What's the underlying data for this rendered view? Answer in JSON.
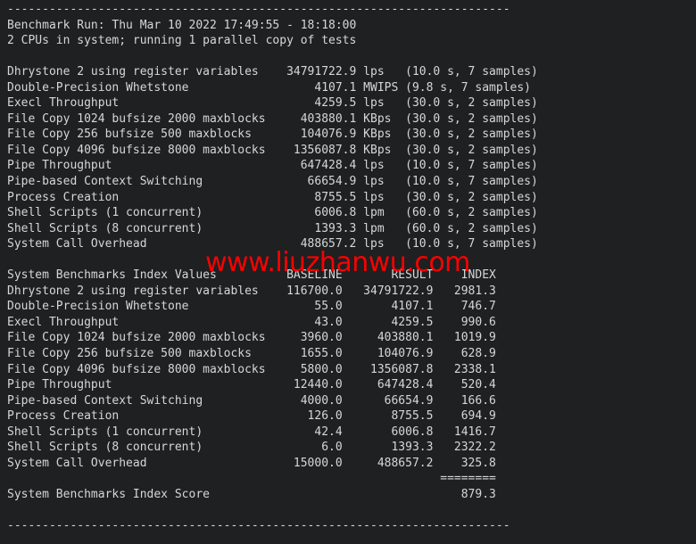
{
  "terminal": {
    "background_color": "#1e2022",
    "text_color": "#d6d8d6",
    "rule_top": "------------------------------------------------------------------------",
    "rule_bottom": "------------------------------------------------------------------------",
    "header": {
      "benchmark_run_label": "Benchmark Run:",
      "benchmark_run_value": "Thu Mar 10 2022 17:49:55 - 18:18:00",
      "cpu_line": "2 CPUs in system; running 1 parallel copy of tests"
    },
    "results_header": {
      "name": "",
      "value": "",
      "unit": "",
      "timing": ""
    },
    "results": [
      {
        "name": "Dhrystone 2 using register variables",
        "value": "34791722.9",
        "unit": "lps",
        "timing": "(10.0 s, 7 samples)"
      },
      {
        "name": "Double-Precision Whetstone",
        "value": "4107.1",
        "unit": "MWIPS",
        "timing": "(9.8 s, 7 samples)"
      },
      {
        "name": "Execl Throughput",
        "value": "4259.5",
        "unit": "lps",
        "timing": "(30.0 s, 2 samples)"
      },
      {
        "name": "File Copy 1024 bufsize 2000 maxblocks",
        "value": "403880.1",
        "unit": "KBps",
        "timing": "(30.0 s, 2 samples)"
      },
      {
        "name": "File Copy 256 bufsize 500 maxblocks",
        "value": "104076.9",
        "unit": "KBps",
        "timing": "(30.0 s, 2 samples)"
      },
      {
        "name": "File Copy 4096 bufsize 8000 maxblocks",
        "value": "1356087.8",
        "unit": "KBps",
        "timing": "(30.0 s, 2 samples)"
      },
      {
        "name": "Pipe Throughput",
        "value": "647428.4",
        "unit": "lps",
        "timing": "(10.0 s, 7 samples)"
      },
      {
        "name": "Pipe-based Context Switching",
        "value": "66654.9",
        "unit": "lps",
        "timing": "(10.0 s, 7 samples)"
      },
      {
        "name": "Process Creation",
        "value": "8755.5",
        "unit": "lps",
        "timing": "(30.0 s, 2 samples)"
      },
      {
        "name": "Shell Scripts (1 concurrent)",
        "value": "6006.8",
        "unit": "lpm",
        "timing": "(60.0 s, 2 samples)"
      },
      {
        "name": "Shell Scripts (8 concurrent)",
        "value": "1393.3",
        "unit": "lpm",
        "timing": "(60.0 s, 2 samples)"
      },
      {
        "name": "System Call Overhead",
        "value": "488657.2",
        "unit": "lps",
        "timing": "(10.0 s, 7 samples)"
      }
    ],
    "index_table": {
      "title": "System Benchmarks Index Values",
      "columns": [
        "BASELINE",
        "RESULT",
        "INDEX"
      ],
      "rows": [
        {
          "name": "Dhrystone 2 using register variables",
          "baseline": "116700.0",
          "result": "34791722.9",
          "index": "2981.3"
        },
        {
          "name": "Double-Precision Whetstone",
          "baseline": "55.0",
          "result": "4107.1",
          "index": "746.7"
        },
        {
          "name": "Execl Throughput",
          "baseline": "43.0",
          "result": "4259.5",
          "index": "990.6"
        },
        {
          "name": "File Copy 1024 bufsize 2000 maxblocks",
          "baseline": "3960.0",
          "result": "403880.1",
          "index": "1019.9"
        },
        {
          "name": "File Copy 256 bufsize 500 maxblocks",
          "baseline": "1655.0",
          "result": "104076.9",
          "index": "628.9"
        },
        {
          "name": "File Copy 4096 bufsize 8000 maxblocks",
          "baseline": "5800.0",
          "result": "1356087.8",
          "index": "2338.1"
        },
        {
          "name": "Pipe Throughput",
          "baseline": "12440.0",
          "result": "647428.4",
          "index": "520.4"
        },
        {
          "name": "Pipe-based Context Switching",
          "baseline": "4000.0",
          "result": "66654.9",
          "index": "166.6"
        },
        {
          "name": "Process Creation",
          "baseline": "126.0",
          "result": "8755.5",
          "index": "694.9"
        },
        {
          "name": "Shell Scripts (1 concurrent)",
          "baseline": "42.4",
          "result": "6006.8",
          "index": "1416.7"
        },
        {
          "name": "Shell Scripts (8 concurrent)",
          "baseline": "6.0",
          "result": "1393.3",
          "index": "2322.2"
        },
        {
          "name": "System Call Overhead",
          "baseline": "15000.0",
          "result": "488657.2",
          "index": "325.8"
        }
      ],
      "separator": "========",
      "score_label": "System Benchmarks Index Score",
      "score_value": "879.3"
    }
  },
  "watermark": {
    "text": "www.liuzhanwu.com",
    "color": "#fc0000"
  }
}
